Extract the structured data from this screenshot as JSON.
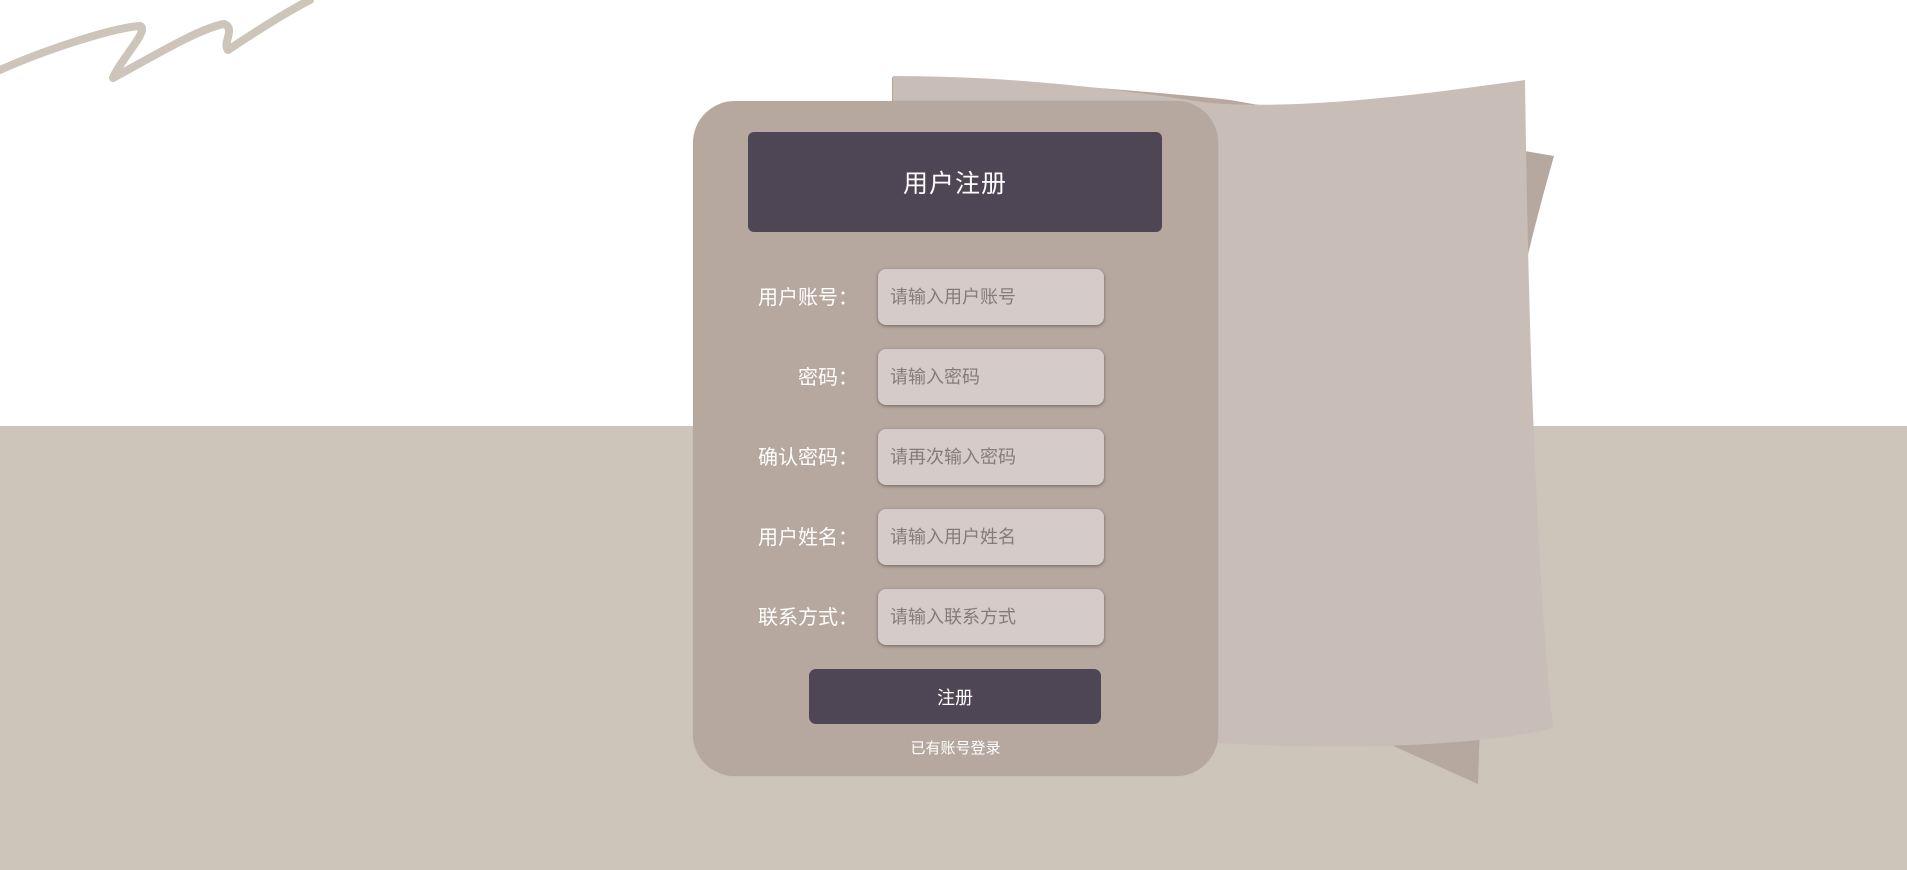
{
  "form": {
    "title": "用户注册",
    "fields": [
      {
        "label": "用户账号：",
        "placeholder": "请输入用户账号",
        "value": ""
      },
      {
        "label": "密码：",
        "placeholder": "请输入密码",
        "value": ""
      },
      {
        "label": "确认密码：",
        "placeholder": "请再次输入密码",
        "value": ""
      },
      {
        "label": "用户姓名：",
        "placeholder": "请输入用户姓名",
        "value": ""
      },
      {
        "label": "联系方式：",
        "placeholder": "请输入联系方式",
        "value": ""
      }
    ],
    "submit_label": "注册",
    "login_link": "已有账号登录"
  },
  "colors": {
    "background": "#ffffff",
    "floor": "#cdc4ba",
    "card": "#b6a79f",
    "accent": "#4f4655",
    "input": "#d5ccc9",
    "paper": "#c9bdb8",
    "scribble": "#cdc4ba"
  }
}
